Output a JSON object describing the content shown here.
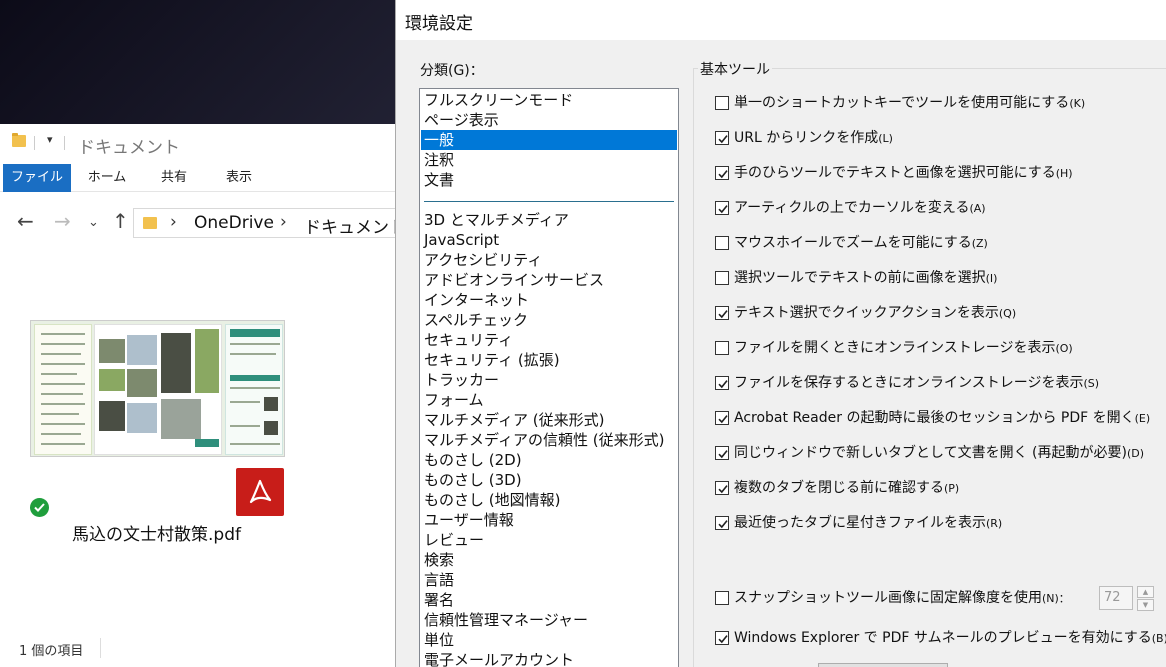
{
  "explorer": {
    "title": "ドキュメント",
    "tabs": [
      "ファイル",
      "ホーム",
      "共有",
      "表示"
    ],
    "address": [
      "OneDrive",
      "ドキュメント"
    ],
    "file_name": "馬込の文士村散策.pdf",
    "status": "1 個の項目"
  },
  "dialog": {
    "title": "環境設定",
    "category_label": "分類(G)：",
    "top_categories": [
      {
        "label": "フルスクリーンモード",
        "selected": false
      },
      {
        "label": "ページ表示",
        "selected": false
      },
      {
        "label": "一般",
        "selected": true
      },
      {
        "label": "注釈",
        "selected": false
      },
      {
        "label": "文書",
        "selected": false
      }
    ],
    "other_categories": [
      "3D とマルチメディア",
      "JavaScript",
      "アクセシビリティ",
      "アドビオンラインサービス",
      "インターネット",
      "スペルチェック",
      "セキュリティ",
      "セキュリティ (拡張)",
      "トラッカー",
      "フォーム",
      "マルチメディア (従来形式)",
      "マルチメディアの信頼性 (従来形式)",
      "ものさし (2D)",
      "ものさし (3D)",
      "ものさし (地図情報)",
      "ユーザー情報",
      "レビュー",
      "検索",
      "言語",
      "署名",
      "信頼性管理マネージャー",
      "単位",
      "電子メールアカウント"
    ],
    "group_title": "基本ツール",
    "options": [
      {
        "label": "単一のショートカットキーでツールを使用可能にする",
        "key": "(K)",
        "checked": false
      },
      {
        "label": "URL からリンクを作成",
        "key": "(L)",
        "checked": true
      },
      {
        "label": "手のひらツールでテキストと画像を選択可能にする",
        "key": "(H)",
        "checked": true
      },
      {
        "label": "アーティクルの上でカーソルを変える",
        "key": "(A)",
        "checked": true
      },
      {
        "label": "マウスホイールでズームを可能にする",
        "key": "(Z)",
        "checked": false
      },
      {
        "label": "選択ツールでテキストの前に画像を選択",
        "key": "(I)",
        "checked": false
      },
      {
        "label": "テキスト選択でクイックアクションを表示",
        "key": "(Q)",
        "checked": true
      },
      {
        "label": "ファイルを開くときにオンラインストレージを表示",
        "key": "(O)",
        "checked": false
      },
      {
        "label": "ファイルを保存するときにオンラインストレージを表示",
        "key": "(S)",
        "checked": true
      },
      {
        "label": "Acrobat Reader の起動時に最後のセッションから PDF を開く",
        "key": "(E)",
        "checked": true
      },
      {
        "label": "同じウィンドウで新しいタブとして文書を開く (再起動が必要)",
        "key": "(D)",
        "checked": true
      },
      {
        "label": "複数のタブを閉じる前に確認する",
        "key": "(P)",
        "checked": true
      },
      {
        "label": "最近使ったタブに星付きファイルを表示",
        "key": "(R)",
        "checked": true
      }
    ],
    "snapshot": {
      "label": "スナップショットツール画像に固定解像度を使用",
      "key": "(N)：",
      "checked": false,
      "value": "72"
    },
    "thumbnail": {
      "label": "Windows Explorer で PDF サムネールのプレビューを有効にする",
      "key": "(B)",
      "checked": true
    }
  }
}
